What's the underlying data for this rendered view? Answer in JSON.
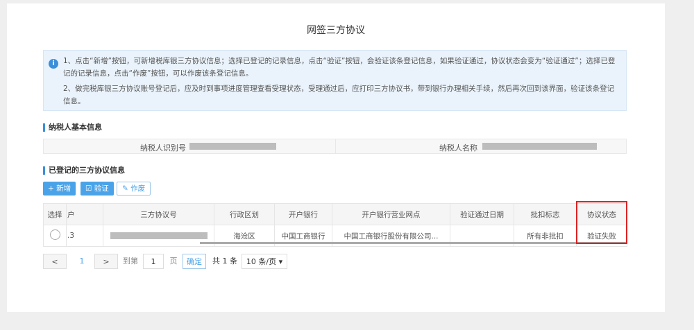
{
  "title": "网签三方协议",
  "info": {
    "line1": "1、点击“新增”按钮，可新增税库银三方协议信息；选择已登记的记录信息，点击“验证”按钮，会验证该条登记信息，如果验证通过，协议状态会变为“验证通过”；选择已登记的记录信息，点击“作废”按钮，可以作废该条登记信息。",
    "line2": "2、做完税库银三方协议账号登记后，应及时到事项进度管理查看受理状态，受理通过后，应打印三方协议书，带到银行办理相关手续，然后再次回到该界面，验证该条登记信息。"
  },
  "taxpayer": {
    "section": "纳税人基本信息",
    "id_label": "纳税人识别号",
    "name_label": "纳税人名称"
  },
  "registered": {
    "section": "已登记的三方协议信息",
    "add": "+ 新增",
    "verify": "☑ 验证",
    "void": "✎ 作废"
  },
  "table": {
    "headers": [
      "选择",
      "户",
      "三方协议号",
      "行政区划",
      "开户银行",
      "开户银行营业网点",
      "验证通过日期",
      "批扣标志",
      "协议状态"
    ],
    "row": {
      "account": ".3",
      "district": "海沧区",
      "bank": "中国工商银行",
      "branch": "中国工商银行股份有限公司...",
      "date": "",
      "flag": "所有非批扣",
      "status": "验证失败"
    }
  },
  "pagination": {
    "prev": "<",
    "page": "1",
    "next": ">",
    "goto": "到第",
    "input": "1",
    "page_unit": "页",
    "confirm": "确定",
    "total": "共 1 条",
    "size": "10 条/页 ▾"
  },
  "colors": {
    "accent": "#4aa3e8",
    "highlight": "#d22222"
  }
}
